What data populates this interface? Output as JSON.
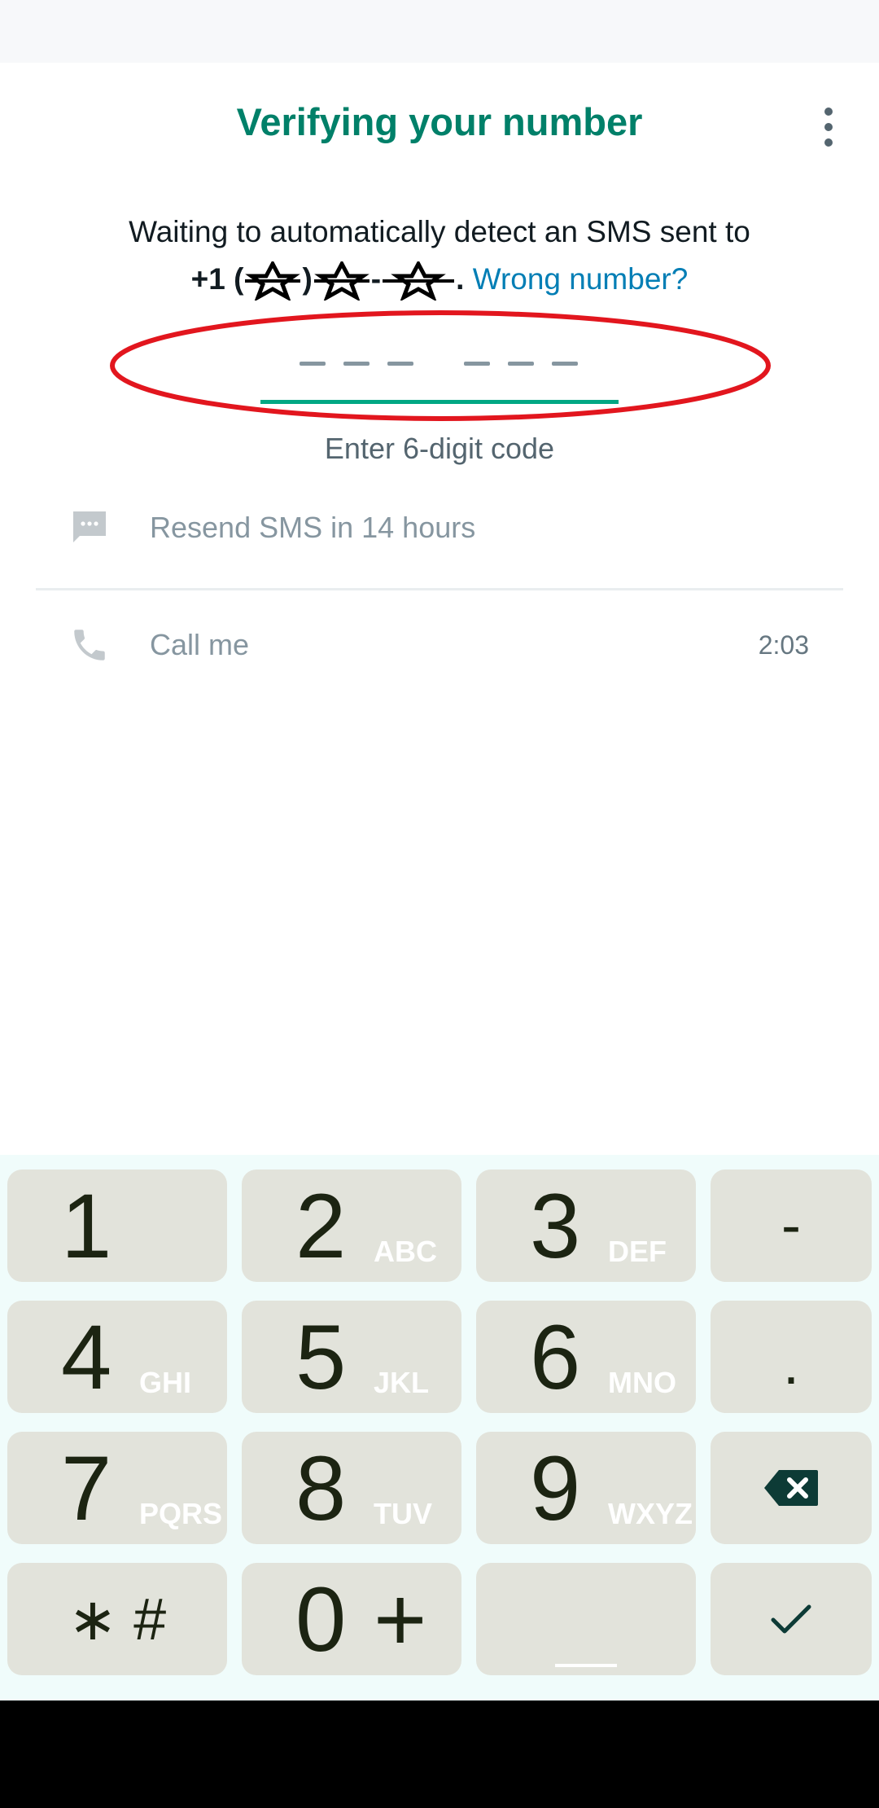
{
  "header": {
    "title": "Verifying your number"
  },
  "message": {
    "line1": "Waiting to automatically detect an SMS sent to",
    "phone_prefix": "+1 (",
    "phone_sep1": ")",
    "phone_sep2": "-",
    "phone_end": ".",
    "wrong_number_link": "Wrong number?"
  },
  "code": {
    "hint": "Enter 6-digit code",
    "digits": 6
  },
  "options": {
    "resend_sms": "Resend SMS in 14 hours",
    "call_me": "Call me",
    "call_timer": "2:03"
  },
  "keypad": {
    "keys": [
      {
        "num": "1",
        "letters": ""
      },
      {
        "num": "2",
        "letters": "ABC"
      },
      {
        "num": "3",
        "letters": "DEF"
      },
      {
        "sym": "-"
      },
      {
        "num": "4",
        "letters": "GHI"
      },
      {
        "num": "5",
        "letters": "JKL"
      },
      {
        "num": "6",
        "letters": "MNO"
      },
      {
        "sym": "."
      },
      {
        "num": "7",
        "letters": "PQRS"
      },
      {
        "num": "8",
        "letters": "TUV"
      },
      {
        "num": "9",
        "letters": "WXYZ"
      },
      {
        "sym": "backspace-icon"
      },
      {
        "sym": "*#"
      },
      {
        "num": "0 +"
      },
      {
        "sym": "space"
      },
      {
        "sym": "check-icon"
      }
    ],
    "key_0": "0",
    "key_plus": "+",
    "key_star_hash": "∗ #",
    "key_dash": "-",
    "key_dot": "."
  },
  "colors": {
    "accent": "#008069",
    "link": "#027eb5",
    "underline": "#00a884",
    "annotation": "#e2161e",
    "key_bg": "#e2e3db",
    "keyboard_bg": "#f0fcfb"
  }
}
